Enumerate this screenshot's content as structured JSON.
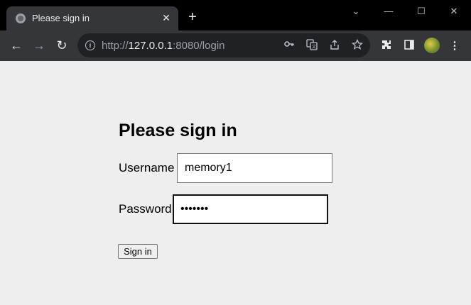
{
  "browser": {
    "tab": {
      "title": "Please sign in",
      "close": "✕",
      "favicon": "globe-icon"
    },
    "new_tab": "+",
    "window_controls": {
      "chevron": "⌄",
      "minimize": "—",
      "maximize": "☐",
      "close": "✕"
    },
    "nav": {
      "back": "←",
      "forward": "→",
      "reload": "↻"
    },
    "address": {
      "scheme": "http://",
      "host": "127.0.0.1",
      "rest": ":8080/login"
    },
    "omnibox_icons": [
      "key-icon",
      "translate-icon",
      "share-icon",
      "star-icon"
    ],
    "toolbar_icons": [
      "extensions-icon",
      "side-panel-icon",
      "profile-avatar",
      "menu-icon"
    ]
  },
  "page": {
    "heading": "Please sign in",
    "username_label": "Username",
    "username_value": "memory1",
    "password_label": "Password",
    "password_value": "•••••••",
    "signin_label": "Sign in"
  }
}
